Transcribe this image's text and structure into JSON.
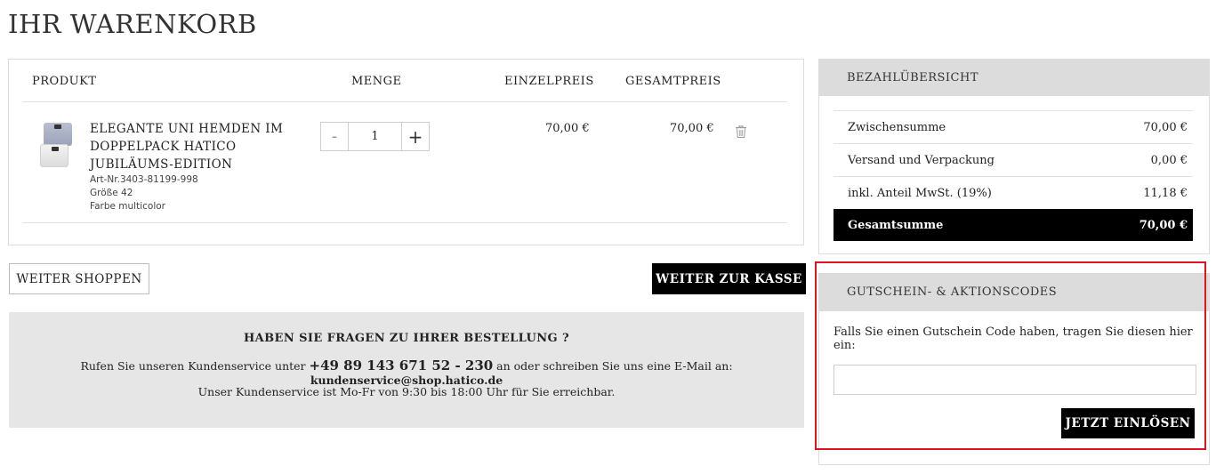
{
  "page": {
    "title": "IHR WARENKORB"
  },
  "cart": {
    "headers": {
      "product": "PRODUKT",
      "quantity": "MENGE",
      "unit_price": "EINZELPREIS",
      "total_price": "GESAMTPREIS"
    },
    "items": [
      {
        "name": "ELEGANTE UNI HEMDEN IM DOPPELPACK HATICO JUBILÄUMS-EDITION",
        "article": "Art-Nr.3403-81199-998",
        "size": "Größe 42",
        "color": "Farbe  multicolor",
        "quantity": "1",
        "unit_price": "70,00 €",
        "total_price": "70,00 €",
        "minus_label": "-",
        "plus_label": "+"
      }
    ]
  },
  "actions": {
    "continue_shopping": "WEITER SHOPPEN",
    "checkout": "WEITER ZUR KASSE"
  },
  "help": {
    "title": "HABEN SIE FRAGEN ZU IHRER BESTELLUNG ?",
    "line1_prefix": "Rufen Sie unseren Kundenservice unter ",
    "phone": "+49 89 143 671 52 - 230",
    "line1_middle": " an oder schreiben Sie uns eine E-Mail an: ",
    "email": "kundenservice@shop.hatico.de",
    "line2": "Unser Kundenservice ist Mo-Fr von 9:30 bis 18:00 Uhr für Sie erreichbar."
  },
  "summary": {
    "title": "BEZAHLÜBERSICHT",
    "rows": [
      {
        "label": "Zwischensumme",
        "value": "70,00 €"
      },
      {
        "label": "Versand und Verpackung",
        "value": "0,00 €"
      },
      {
        "label": "inkl. Anteil MwSt. (19%)",
        "value": "11,18 €"
      }
    ],
    "total": {
      "label": "Gesamtsumme",
      "value": "70,00 €"
    }
  },
  "voucher": {
    "title": "GUTSCHEIN- & AKTIONSCODES",
    "text": "Falls Sie einen Gutschein Code haben, tragen Sie diesen hier ein:",
    "input_value": "",
    "button": "JETZT EINLÖSEN"
  },
  "colors": {
    "highlight": "#e0141e",
    "panel_gray": "#dcdcdc",
    "help_gray": "#e6e6e6",
    "black": "#000000"
  }
}
